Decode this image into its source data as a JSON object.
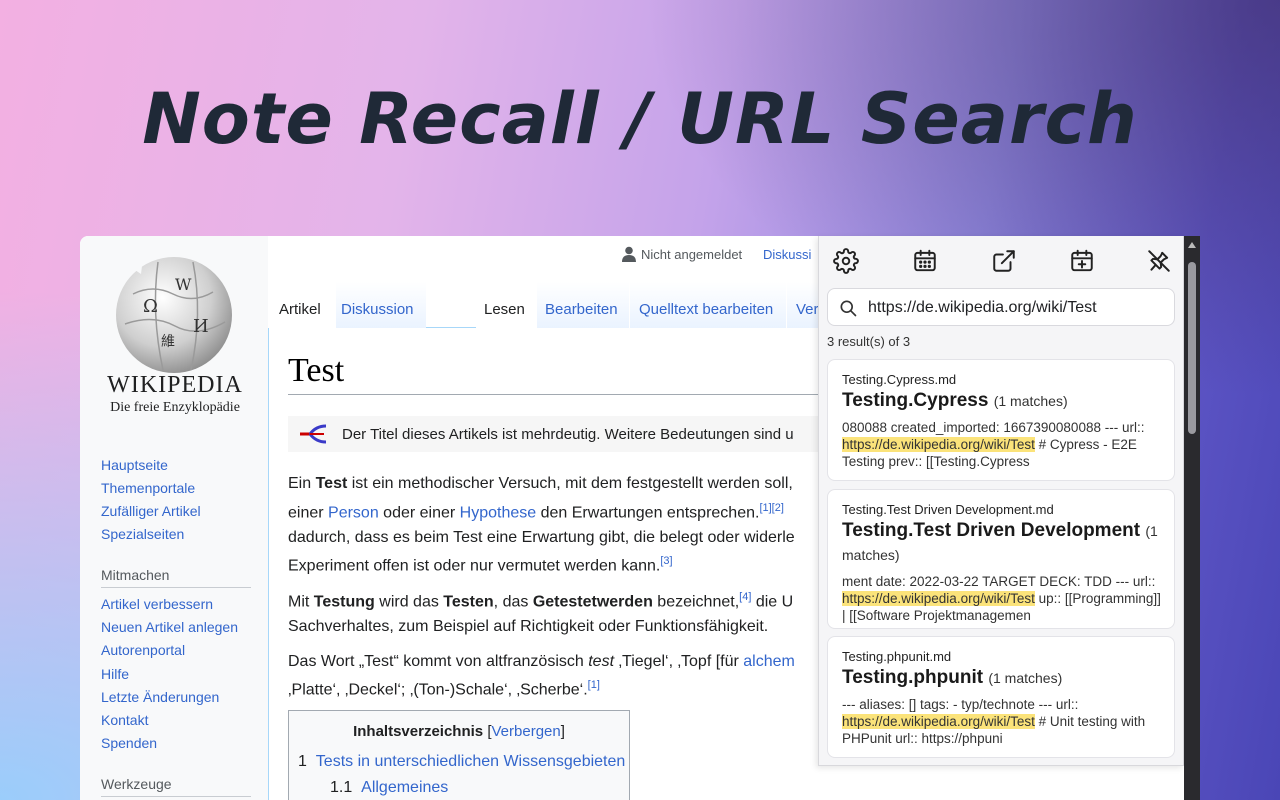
{
  "hero": {
    "title": "Note Recall / URL Search"
  },
  "wiki": {
    "wordmark": "WIKIPEDIA",
    "tagline": "Die freie Enzyklopädie",
    "nav_main": [
      "Hauptseite",
      "Themenportale",
      "Zufälliger Artikel",
      "Spezialseiten"
    ],
    "mitmachen_heading": "Mitmachen",
    "nav_mitmachen": [
      "Artikel verbessern",
      "Neuen Artikel anlegen",
      "Autorenportal",
      "Hilfe",
      "Letzte Änderungen",
      "Kontakt",
      "Spenden"
    ],
    "werkzeuge_heading": "Werkzeuge",
    "top": {
      "not_logged_in": "Nicht angemeldet",
      "discussion": "Diskussi"
    },
    "tabs": {
      "article": "Artikel",
      "discussion": "Diskussion",
      "read": "Lesen",
      "edit": "Bearbeiten",
      "edit_source": "Quelltext bearbeiten",
      "versions": "Ver"
    },
    "page_title": "Test",
    "hatnote": "Der Titel dieses Artikels ist mehrdeutig. Weitere Bedeutungen sind u",
    "p1": {
      "a": "Ein ",
      "b": "Test",
      "c": " ist ein methodischer Versuch, mit dem festgestellt werden soll,",
      "d": "einer ",
      "person": "Person",
      "e": " oder einer ",
      "hypothese": "Hypothese",
      "f": " den Erwartungen entsprechen.",
      "ref1": "[1]",
      "ref2": "[2]",
      "g": "dadurch, dass es beim Test eine Erwartung gibt, die belegt oder widerle",
      "h": "Experiment offen ist oder nur vermutet werden kann.",
      "ref3": "[3]"
    },
    "p2": {
      "a": "Mit ",
      "b": "Testung",
      "c": " wird das ",
      "d": "Testen",
      "e": ", das ",
      "f": "Getestetwerden",
      "g": " bezeichnet,",
      "ref4": "[4]",
      "h": " die U",
      "i": "Sachverhaltes, zum Beispiel auf Richtigkeit oder Funktionsfähigkeit."
    },
    "p3": {
      "a": "Das Wort „Test“ kommt von altfranzösisch ",
      "b": "test",
      "c": " ‚Tiegel‘, ‚Topf [für ",
      "d": "alchem",
      "e": "‚Platte‘, ‚Deckel‘; ‚(Ton-)Schale‘, ‚Scherbe‘.",
      "ref1": "[1]"
    },
    "toc": {
      "title": "Inhaltsverzeichnis",
      "toggle_open": "[",
      "toggle": "Verbergen",
      "toggle_close": "]",
      "items": [
        {
          "num": "1",
          "label": "Tests in unterschiedlichen Wissensgebieten"
        },
        {
          "num": "1.1",
          "label": "Allgemeines"
        }
      ]
    }
  },
  "popup": {
    "toolbar": [
      "settings-icon",
      "calendar-icon",
      "open-external-icon",
      "add-date-icon",
      "unpin-icon"
    ],
    "search": {
      "value": "https://de.wikipedia.org/wiki/Test",
      "placeholder": "Search"
    },
    "result_count": "3 result(s) of 3",
    "results": [
      {
        "file": "Testing.Cypress.md",
        "title": "Testing.Cypress",
        "matches": "(1 matches)",
        "snippet_pre": "080088 created_imported: 1667390080088 --- url:: ",
        "snippet_hl": "https://de.wikipedia.org/wiki/Test",
        "snippet_post": " # Cypress - E2E Testing prev:: [[Testing.Cypress"
      },
      {
        "file": "Testing.Test Driven Development.md",
        "title": "Testing.Test Driven Development",
        "matches": "(1 matches)",
        "snippet_pre": "ment date: 2022-03-22 TARGET DECK: TDD --- url:: ",
        "snippet_hl": "https://de.wikipedia.org/wiki/Test",
        "snippet_post": " up:: [[Programming]] | [[Software Projektmanagemen"
      },
      {
        "file": "Testing.phpunit.md",
        "title": "Testing.phpunit",
        "matches": "(1 matches)",
        "snippet_pre": "--- aliases: [] tags: - typ/technote --- url:: ",
        "snippet_hl": "https://de.wikipedia.org/wiki/Test",
        "snippet_post": " # Unit testing with PHPunit url:: https://phpuni"
      }
    ]
  }
}
